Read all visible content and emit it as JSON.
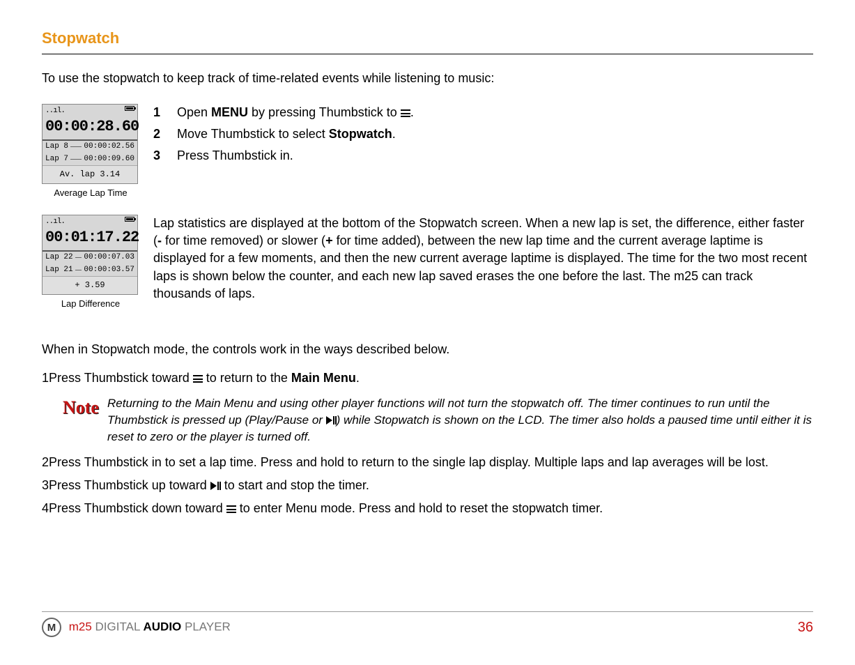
{
  "heading": "Stopwatch",
  "intro": "To use the stopwatch to keep track of time-related events while listening to music:",
  "lcd1": {
    "big": "00:00:28.60",
    "row1_a": "Lap 8",
    "row1_b": "00:00:02.56",
    "row2_a": "Lap 7",
    "row2_b": "00:00:09.60",
    "foot": "Av. lap 3.14",
    "caption": "Average Lap Time"
  },
  "lcd2": {
    "big": "00:01:17.22",
    "row1_a": "Lap 22",
    "row1_b": "00:00:07.03",
    "row2_a": "Lap 21",
    "row2_b": "00:00:03.57",
    "foot": "+ 3.59",
    "caption": "Lap Difference"
  },
  "steps_a": {
    "s1a": "Open ",
    "s1b": "MENU",
    "s1c": " by pressing Thumbstick to ",
    "s1d": ".",
    "s2a": "Move Thumbstick to select ",
    "s2b": "Stopwatch",
    "s2c": ".",
    "s3": "Press Thumbstick in."
  },
  "lap_para_a": "Lap statistics are displayed at the bottom of the Stopwatch screen. When a new lap is set, the difference, either faster (",
  "lap_para_b": "-",
  "lap_para_c": " for time removed) or slower (",
  "lap_para_d": "+",
  "lap_para_e": " for time added), between the new lap time and the current average laptime is displayed for a few moments, and then the new current average laptime is displayed. The time for the two most recent laps is shown below the counter, and each new lap saved erases the one before the last. The m25 can track thousands of laps.",
  "mid": "When in Stopwatch mode, the controls work in the ways described below.",
  "b1a": "Press Thumbstick toward ",
  "b1b": " to return to the ",
  "b1c": "Main Menu",
  "b1d": ".",
  "note_a": "Returning to the Main Menu and using other player functions will not turn the stopwatch off. The timer continues to run until the Thumbstick is pressed up (Play/Pause or ",
  "note_b": ") while Stopwatch is shown on the LCD. The timer also holds a paused time until either it is reset to zero or the player is turned off.",
  "b2": "Press Thumbstick in to set a lap time. Press and hold to return to the single lap display. Multiple laps and lap averages will be lost.",
  "b3a": "Press Thumbstick up toward ",
  "b3b": " to start and stop the timer.",
  "b4a": "Press Thumbstick down toward ",
  "b4b": " to enter Menu mode. Press and hold to reset the stopwatch timer.",
  "footer": {
    "m": "m25 ",
    "d": "DIGITAL ",
    "a": "AUDIO",
    "p": " PLAYER",
    "page": "36"
  },
  "note_label": "Note",
  "moto": "M"
}
